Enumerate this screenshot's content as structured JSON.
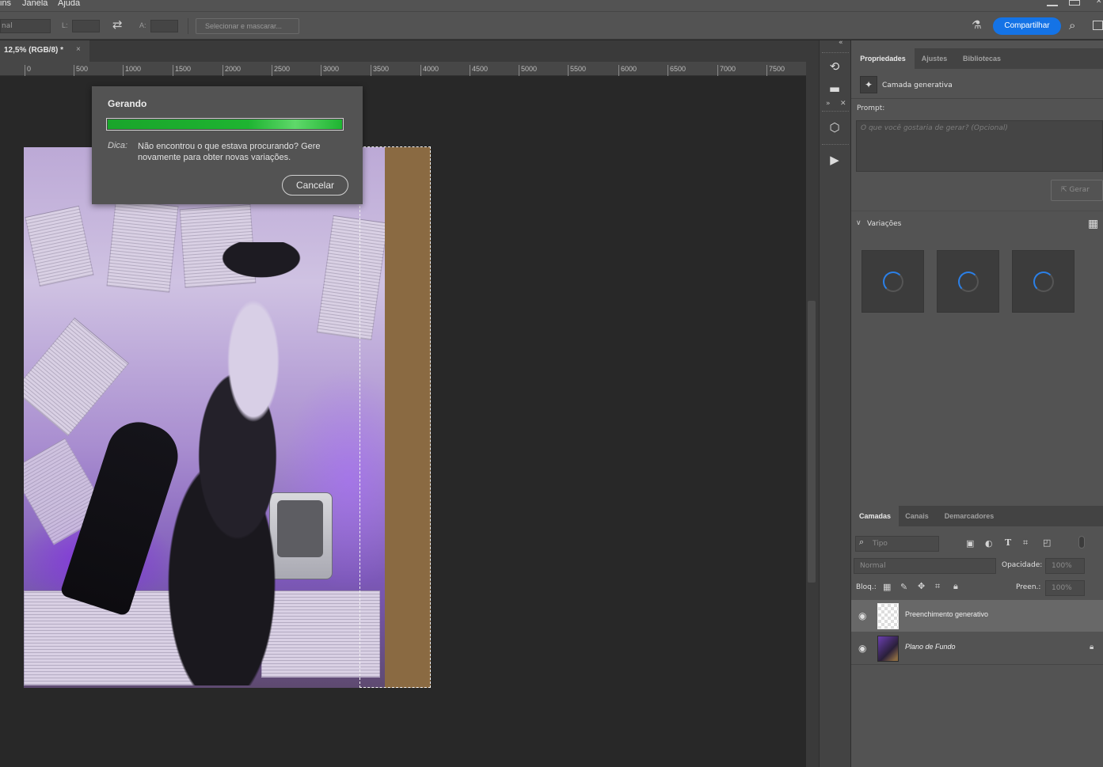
{
  "menubar": {
    "items": [
      "ins",
      "Janela",
      "Ajuda"
    ]
  },
  "options": {
    "mode_value": "nal",
    "width_label": "L:",
    "height_label": "A:",
    "select_mask_label": "Selecionar e mascarar...",
    "share_label": "Compartilhar"
  },
  "document": {
    "tab_label": "12,5% (RGB/8) *",
    "ruler_ticks": [
      "0",
      "500",
      "1000",
      "1500",
      "2000",
      "2500",
      "3000",
      "3500",
      "4000",
      "4500",
      "5000",
      "5500",
      "6000",
      "6500",
      "7000",
      "7500"
    ]
  },
  "generating_dialog": {
    "title": "Gerando",
    "progress": 1.0,
    "tip_label": "Dica:",
    "tip_text": "Não encontrou o que estava procurando? Gere novamente para obter novas variações.",
    "cancel_label": "Cancelar"
  },
  "properties": {
    "tabs": [
      "Propriedades",
      "Ajustes",
      "Bibliotecas"
    ],
    "layer_type": "Camada generativa",
    "prompt_label": "Prompt:",
    "prompt_placeholder": "O que você gostaria de gerar? (Opcional)",
    "generate_label": "Gerar",
    "variations_label": "Variações",
    "variation_count": 3
  },
  "layers": {
    "tabs": [
      "Camadas",
      "Canais",
      "Demarcadores"
    ],
    "filter_placeholder": "Tipo",
    "blend_mode": "Normal",
    "opacity_label": "Opacidade:",
    "opacity_value": "100%",
    "lock_label": "Bloq.:",
    "fill_label": "Preen.:",
    "fill_value": "100%",
    "items": [
      {
        "name": "Preenchimento generativo",
        "visible": true,
        "selected": true
      },
      {
        "name": "Plano de Fundo",
        "visible": true,
        "locked": true
      }
    ]
  },
  "colors": {
    "accent": "#1473e6",
    "progress": "#1eb431",
    "fill_brown": "#8a6a42"
  }
}
